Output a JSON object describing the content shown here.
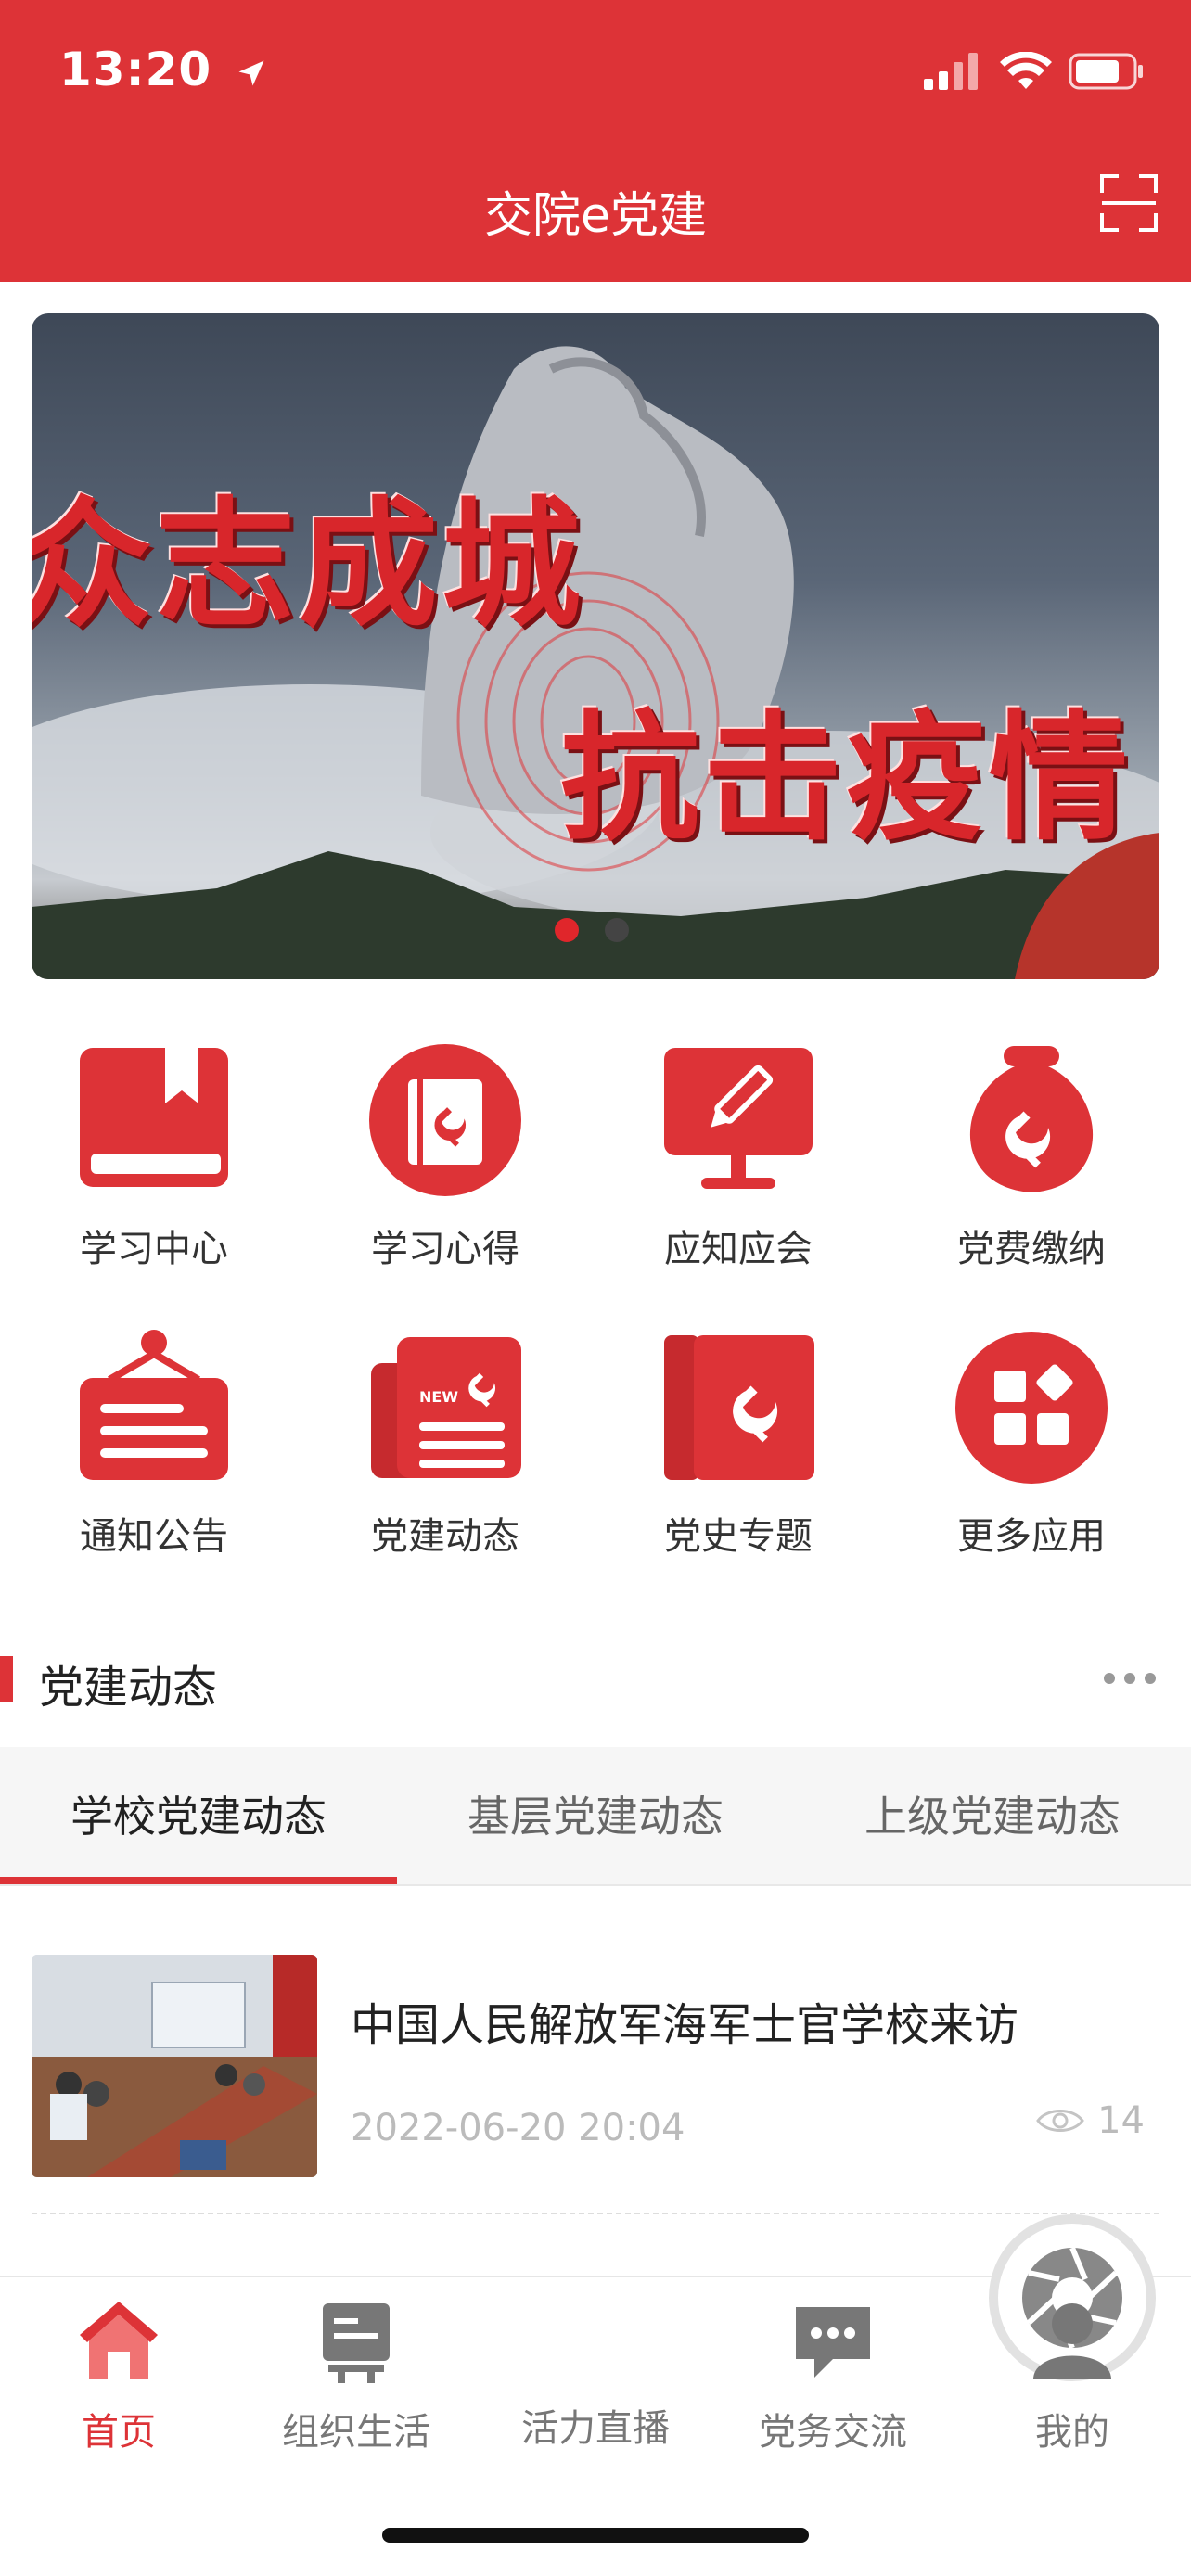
{
  "status": {
    "time": "13:20"
  },
  "header": {
    "title": "交院e党建"
  },
  "banner": {
    "text_line1": "众志成城",
    "text_line2": "抗击疫情",
    "slide_count": 2,
    "active_slide": 1
  },
  "grid": [
    {
      "label": "学习中心",
      "icon": "book-icon"
    },
    {
      "label": "学习心得",
      "icon": "notebook-icon"
    },
    {
      "label": "应知应会",
      "icon": "monitor-pencil-icon"
    },
    {
      "label": "党费缴纳",
      "icon": "money-bag-icon"
    },
    {
      "label": "通知公告",
      "icon": "notice-board-icon"
    },
    {
      "label": "党建动态",
      "icon": "newspaper-icon"
    },
    {
      "label": "党史专题",
      "icon": "party-history-book-icon"
    },
    {
      "label": "更多应用",
      "icon": "more-apps-icon"
    }
  ],
  "section": {
    "title": "党建动态"
  },
  "tabs": [
    {
      "label": "学校党建动态",
      "active": true
    },
    {
      "label": "基层党建动态",
      "active": false
    },
    {
      "label": "上级党建动态",
      "active": false
    }
  ],
  "news": [
    {
      "title": "中国人民解放军海军士官学校来访",
      "date": "2022-06-20 20:04",
      "views": "14"
    }
  ],
  "nav": [
    {
      "label": "首页",
      "icon": "home-icon",
      "active": true
    },
    {
      "label": "组织生活",
      "icon": "org-life-icon",
      "active": false
    },
    {
      "label": "活力直播",
      "icon": "camera-aperture-icon",
      "active": false
    },
    {
      "label": "党务交流",
      "icon": "chat-icon",
      "active": false
    },
    {
      "label": "我的",
      "icon": "user-icon",
      "active": false
    }
  ],
  "colors": {
    "primary": "#dd3337",
    "inactive": "#777777"
  }
}
